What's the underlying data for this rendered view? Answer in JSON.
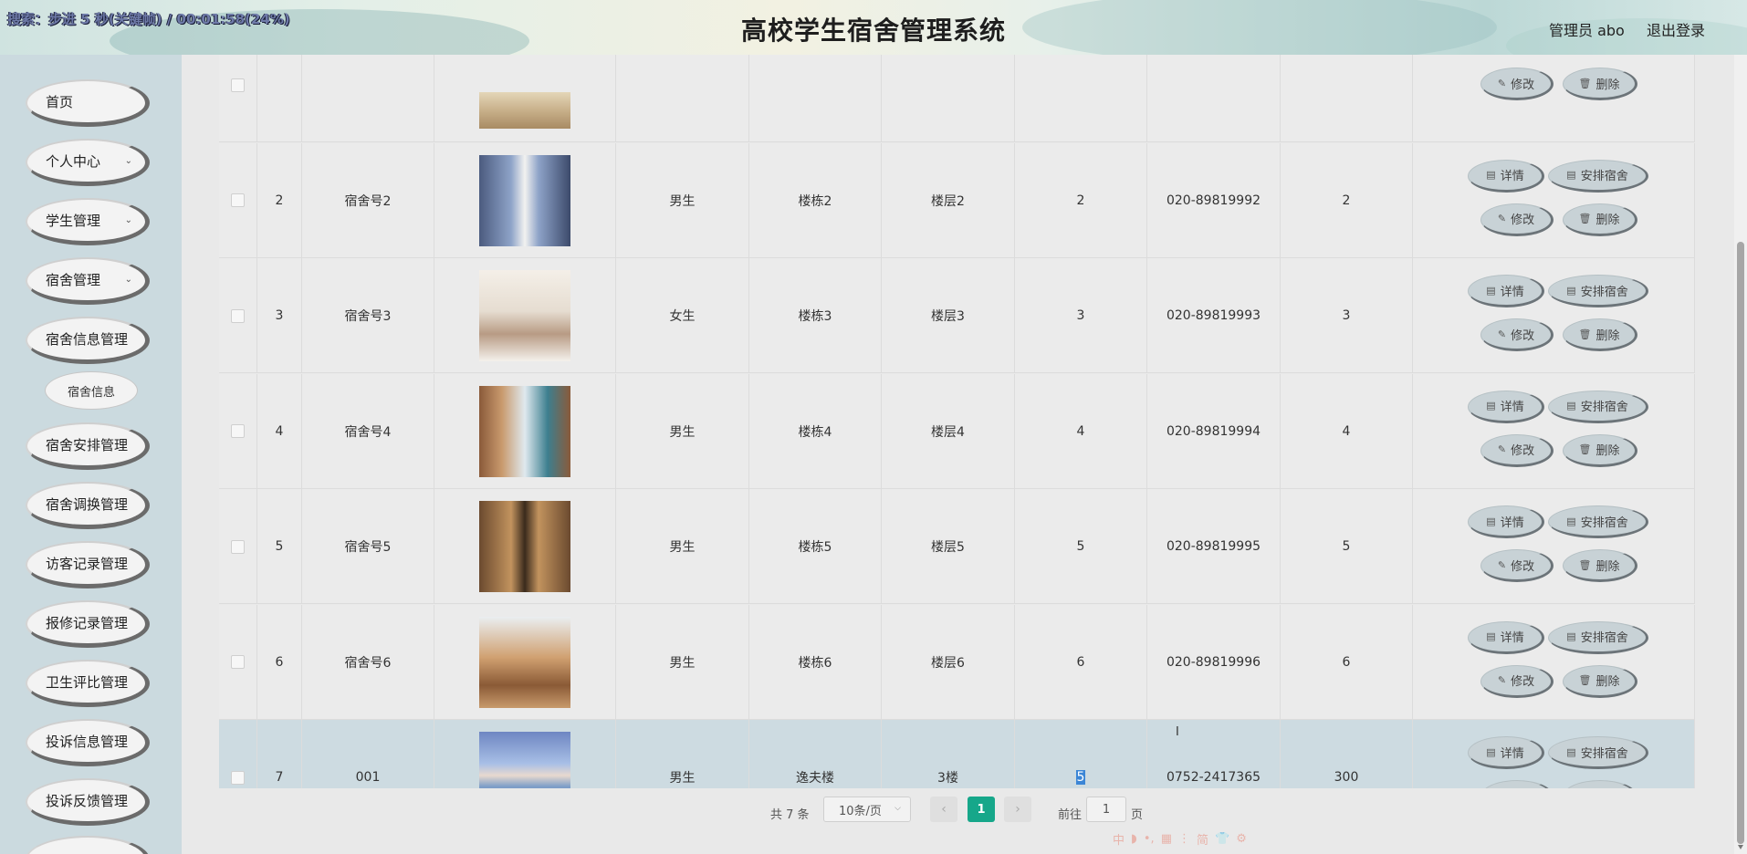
{
  "header": {
    "recording_banner": "搜索：步进 5 秒(关键帧) / 00:01:58(24%)",
    "title": "高校学生宿舍管理系统",
    "user_label": "管理员 abo",
    "logout_label": "退出登录"
  },
  "sidebar": {
    "items": [
      {
        "label": "首页",
        "has_chevron": false
      },
      {
        "label": "个人中心",
        "has_chevron": true
      },
      {
        "label": "学生管理",
        "has_chevron": true
      },
      {
        "label": "宿舍管理",
        "has_chevron": true
      },
      {
        "label": "宿舍信息管理",
        "has_chevron": false
      },
      {
        "label": "宿舍信息",
        "sub": true
      },
      {
        "label": "宿舍安排管理",
        "has_chevron": false
      },
      {
        "label": "宿舍调换管理",
        "has_chevron": false
      },
      {
        "label": "访客记录管理",
        "has_chevron": false
      },
      {
        "label": "报修记录管理",
        "has_chevron": false
      },
      {
        "label": "卫生评比管理",
        "has_chevron": false
      },
      {
        "label": "投诉信息管理",
        "has_chevron": false
      },
      {
        "label": "投诉反馈管理",
        "has_chevron": false
      }
    ]
  },
  "table": {
    "actions": {
      "detail": "详情",
      "assign": "安排宿舍",
      "edit": "修改",
      "delete": "删除"
    },
    "rows": [
      {
        "index": "",
        "room": "",
        "gender": "",
        "building": "",
        "floor": "",
        "capacity": "",
        "phone": "",
        "fee": "",
        "photo": "room1",
        "partial": true
      },
      {
        "index": "2",
        "room": "宿舍号2",
        "gender": "男生",
        "building": "楼栋2",
        "floor": "楼层2",
        "capacity": "2",
        "phone": "020-89819992",
        "fee": "2",
        "photo": "room2"
      },
      {
        "index": "3",
        "room": "宿舍号3",
        "gender": "女生",
        "building": "楼栋3",
        "floor": "楼层3",
        "capacity": "3",
        "phone": "020-89819993",
        "fee": "3",
        "photo": "room3"
      },
      {
        "index": "4",
        "room": "宿舍号4",
        "gender": "男生",
        "building": "楼栋4",
        "floor": "楼层4",
        "capacity": "4",
        "phone": "020-89819994",
        "fee": "4",
        "photo": "room4"
      },
      {
        "index": "5",
        "room": "宿舍号5",
        "gender": "男生",
        "building": "楼栋5",
        "floor": "楼层5",
        "capacity": "5",
        "phone": "020-89819995",
        "fee": "5",
        "photo": "room5"
      },
      {
        "index": "6",
        "room": "宿舍号6",
        "gender": "男生",
        "building": "楼栋6",
        "floor": "楼层6",
        "capacity": "6",
        "phone": "020-89819996",
        "fee": "6",
        "photo": "room6"
      },
      {
        "index": "7",
        "room": "001",
        "gender": "男生",
        "building": "逸夫楼",
        "floor": "3楼",
        "capacity": "5",
        "phone": "0752-2417365",
        "fee": "300",
        "photo": "bridge",
        "selected": true,
        "capacity_highlighted": true
      }
    ]
  },
  "pagination": {
    "total": "共 7 条",
    "page_size": "10条/页",
    "prev": "‹",
    "current": "1",
    "next": "›",
    "goto_label": "前往",
    "goto_value": "1",
    "page_suffix": "页"
  },
  "ime_toolbar": [
    "中",
    "◗",
    "•,",
    "▦",
    "⋮",
    "简",
    "👕",
    "⚙"
  ],
  "colors": {
    "accent": "#16a78a",
    "selected_row": "#cddbe1",
    "sidebar_bg": "#cbdadf",
    "button_bg": "#c8d2d6"
  }
}
